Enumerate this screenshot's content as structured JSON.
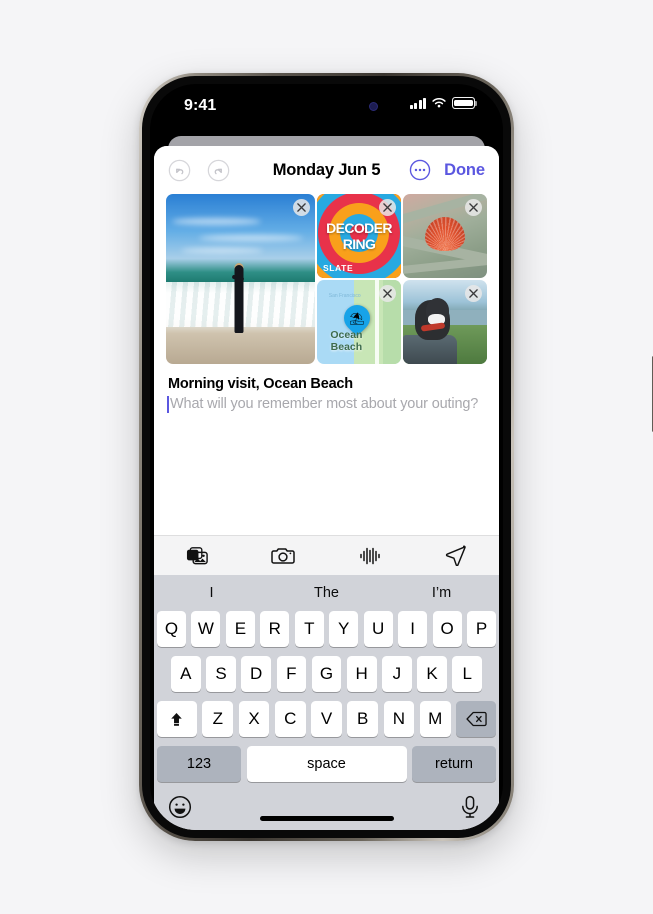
{
  "device": {
    "status_bar": {
      "time": "9:41",
      "cellular_icon": "cellular-bars-icon",
      "wifi_icon": "wifi-icon",
      "battery_icon": "battery-full-icon"
    }
  },
  "navbar": {
    "undo_icon": "undo-arrow-icon",
    "redo_icon": "redo-arrow-icon",
    "title": "Monday Jun 5",
    "more_icon": "more-ellipsis-icon",
    "done_label": "Done"
  },
  "attachments": [
    {
      "name": "photo-surfer-beach",
      "alt": "Person in wetsuit walking out of the ocean surf",
      "remove_label": "×"
    },
    {
      "name": "podcast-decoder-ring",
      "title_line1": "DECODER",
      "title_line2": "RING",
      "publisher": "SLATE",
      "remove_label": "×"
    },
    {
      "name": "photo-seashell",
      "alt": "Orange scallop seashell resting on green rope netting",
      "remove_label": "×"
    },
    {
      "name": "map-ocean-beach",
      "label_line1": "Ocean",
      "label_line2": "Beach",
      "pin_icon": "beach-umbrella-pin-icon",
      "ghost_label": "San Francisco",
      "remove_label": "×"
    },
    {
      "name": "photo-dog-in-car",
      "alt": "Black and white dog looking out a car window at the coast",
      "remove_label": "×"
    }
  ],
  "note": {
    "title": "Morning visit, Ocean Beach",
    "placeholder": "What will you remember most about your outing?"
  },
  "accessory_toolbar": [
    {
      "name": "photo-library-button",
      "icon": "photo-library-icon"
    },
    {
      "name": "camera-button",
      "icon": "camera-icon"
    },
    {
      "name": "audio-record-button",
      "icon": "audio-waveform-icon"
    },
    {
      "name": "location-button",
      "icon": "location-arrow-icon"
    }
  ],
  "keyboard": {
    "predictions": [
      "I",
      "The",
      "I’m"
    ],
    "row1": [
      "Q",
      "W",
      "E",
      "R",
      "T",
      "Y",
      "U",
      "I",
      "O",
      "P"
    ],
    "row2": [
      "A",
      "S",
      "D",
      "F",
      "G",
      "H",
      "J",
      "K",
      "L"
    ],
    "row3": [
      "Z",
      "X",
      "C",
      "V",
      "B",
      "N",
      "M"
    ],
    "shift_icon": "shift-arrow-icon",
    "backspace_icon": "backspace-delete-icon",
    "numbers_label": "123",
    "space_label": "space",
    "return_label": "return",
    "emoji_icon": "emoji-smiley-icon",
    "dictation_icon": "microphone-icon"
  },
  "colors": {
    "accent": "#5b57e0",
    "page_background": "#f5f5f7",
    "keyboard_background": "#d1d3d9",
    "key_white": "#ffffff",
    "key_gray": "#adb3bd",
    "placeholder_text": "#a8a8ad"
  }
}
